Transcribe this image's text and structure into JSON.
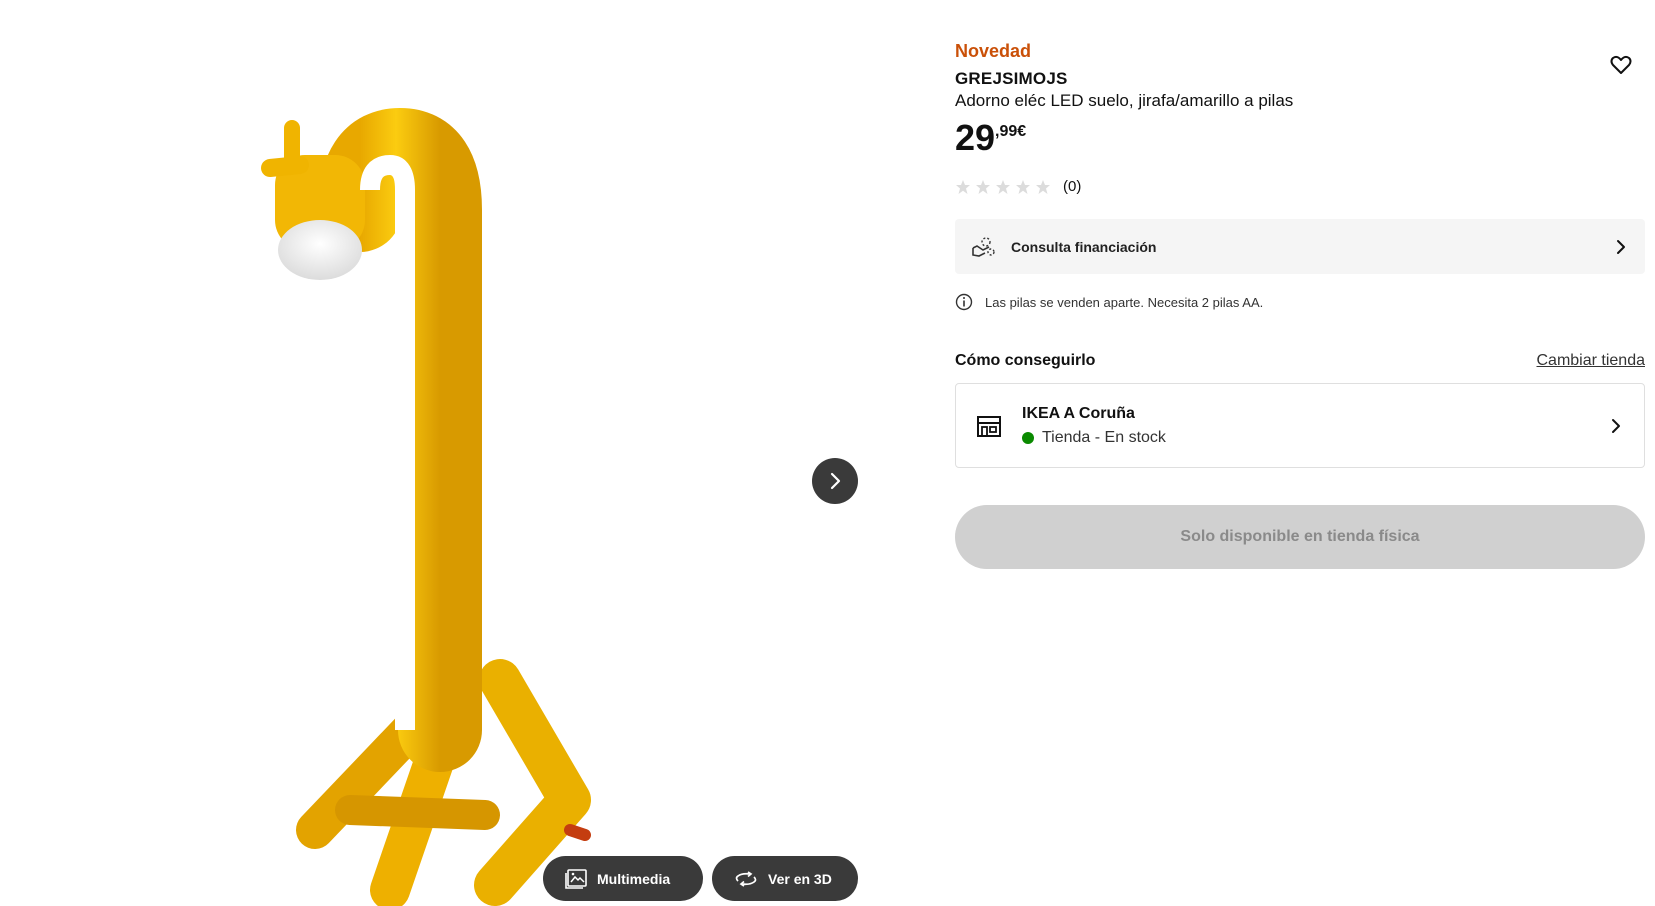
{
  "gallery": {
    "image_alt": "GREJSIMOJS giraffe lamp",
    "multimedia_label": "Multimedia",
    "view3d_label": "Ver en 3D",
    "icons": {
      "next": "chevron-right-icon",
      "multimedia": "gallery-icon",
      "view3d": "rotate-icon"
    }
  },
  "product": {
    "badge": "Novedad",
    "name": "GREJSIMOJS",
    "description": "Adorno eléc LED suelo, jirafa/amarillo a pilas",
    "price_integer": "29",
    "price_decimal": ",99€",
    "rating_stars": 0,
    "rating_count": "(0)"
  },
  "finance": {
    "label": "Consulta financiación"
  },
  "notice": {
    "text": "Las pilas se venden aparte. Necesita 2 pilas AA."
  },
  "availability": {
    "title": "Cómo conseguirlo",
    "change_store": "Cambiar tienda",
    "store_name": "IKEA A Coruña",
    "stock_status": "Tienda - En stock",
    "button_label": "Solo disponible en tienda física"
  },
  "colors": {
    "badge": "#ca5008",
    "stock_dot": "#0a8a00",
    "product_yellow": "#f2b705",
    "disabled_button": "#d0d0d0"
  }
}
